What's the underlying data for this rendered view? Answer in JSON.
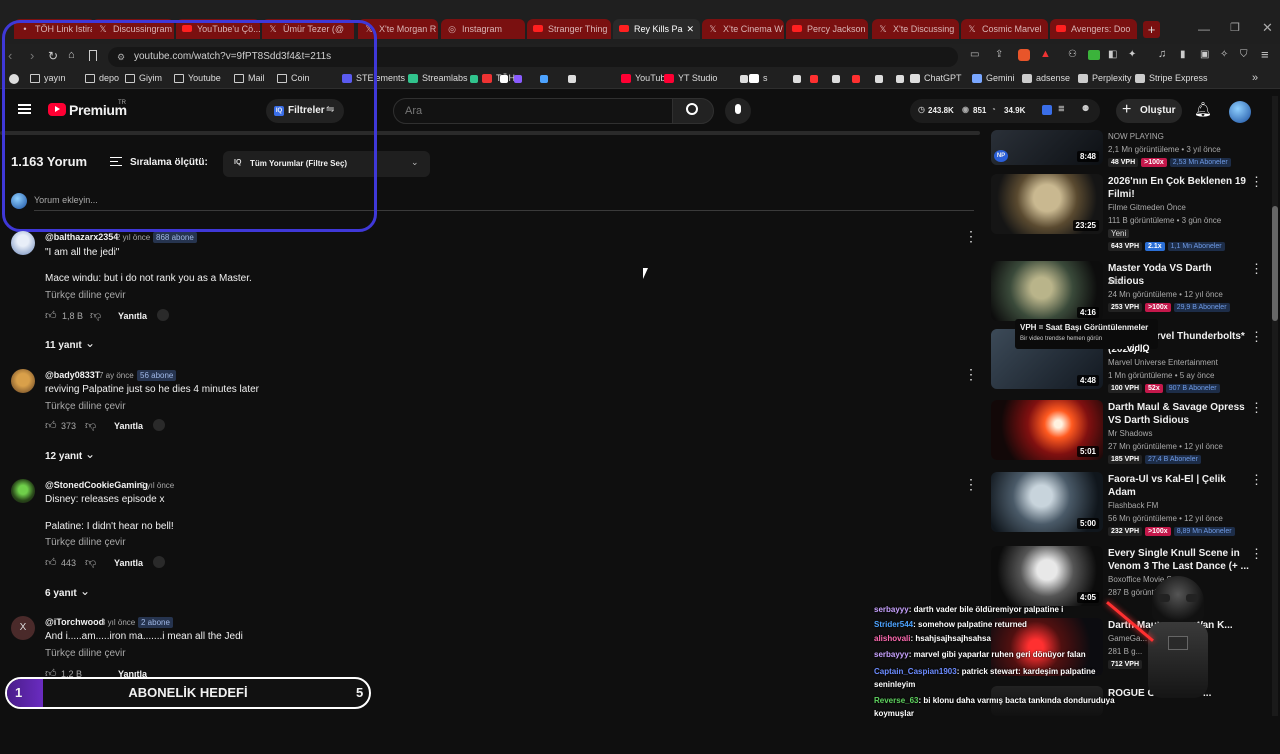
{
  "browser": {
    "tabs": [
      {
        "label": "TÖH Link Istiraki"
      },
      {
        "label": "Discussingram"
      },
      {
        "label": "YouTube'u Çö..."
      },
      {
        "label": "Ümür Tezer (@"
      },
      {
        "label": "X'te Morgan R"
      },
      {
        "label": "Instagram"
      },
      {
        "label": "Stranger Thing"
      },
      {
        "label": "Rey Kills Pa"
      },
      {
        "label": "X'te Cinema W"
      },
      {
        "label": "Percy Jackson"
      },
      {
        "label": "X'te Discussing"
      },
      {
        "label": "Cosmic Marvel"
      },
      {
        "label": "Avengers: Doo"
      }
    ],
    "url": "youtube.com/watch?v=9fPT8Sdd3f4&t=211s",
    "bookmarks": [
      "yayın",
      "depo",
      "Giyim",
      "Youtube",
      "Mail",
      "Coin",
      "STElements",
      "Streamlabs",
      "TÖH",
      "YouTube",
      "YT Studio",
      "s",
      "ChatGPT",
      "Gemini",
      "adsense",
      "Perplexity",
      "Stripe Express"
    ]
  },
  "yt": {
    "logo": "Premium",
    "logo_region": "TR",
    "filters_label": "Filtreler",
    "search_placeholder": "Ara",
    "stats": {
      "a": "243.8K",
      "b": "851",
      "c": "34.9K"
    },
    "create_label": "Oluştur"
  },
  "comments_header": {
    "count": "1.163 Yorum",
    "sort_label": "Sıralama ölçütü:",
    "filter_value": "Tüm Yorumlar (Filtre Seç)",
    "add_placeholder": "Yorum ekleyin..."
  },
  "comments": [
    {
      "user": "@balthazarx2354",
      "ago": "2 yıl önce",
      "subs": "868 abone",
      "lines": [
        "\"I am all the jedi\"",
        "Mace windu: but i do not rank you as a Master."
      ],
      "translate": "Türkçe diline çevir",
      "likes": "1,8 B",
      "reply": "Yanıtla",
      "replies": "11 yanıt"
    },
    {
      "user": "@bady0833T",
      "ago": "7 ay önce",
      "subs": "56 abone",
      "lines": [
        "reviving Palpatine just so he dies 4 minutes later"
      ],
      "translate": "Türkçe diline çevir",
      "likes": "373",
      "reply": "Yanıtla",
      "replies": "12 yanıt"
    },
    {
      "user": "@StonedCookieGaming",
      "ago": "2 yıl önce",
      "subs": "",
      "lines": [
        "Disney: releases episode x",
        "Palatine: I didn't hear no bell!"
      ],
      "translate": "Türkçe diline çevir",
      "likes": "443",
      "reply": "Yanıtla",
      "replies": "6 yanıt"
    },
    {
      "user": "@iTorchwood",
      "ago": "3 yıl önce",
      "subs": "2 abone",
      "avatar_letter": "X",
      "lines": [
        "And i.....am.....iron ma.......i mean all the Jedi"
      ],
      "translate": "Türkçe diline çevir",
      "likes": "1,2 B",
      "reply": "Yanıtla",
      "replies": ""
    }
  ],
  "sidebar": [
    {
      "title": "",
      "channel": "NOW PLAYING",
      "views": "2,1 Mn görüntüleme • 3 yıl önce",
      "duration": "8:48",
      "vph": "48 VPH",
      "mult": ">100x",
      "mult_color": "#c4184b",
      "subs": "2,53 Mn Aboneler"
    },
    {
      "title": "2026'nın En Çok Beklenen 19 Filmi!",
      "channel": "Filme Gitmeden Önce",
      "views": "111 B görüntüleme • 3 gün önce",
      "badge": "Yeni",
      "duration": "23:25",
      "vph": "643 VPH",
      "mult": "2.1x",
      "mult_color": "#2b6fd6",
      "subs": "1,1 Mn Aboneler"
    },
    {
      "title": "Master Yoda VS Darth Sidious",
      "channel": "Alex",
      "views": "24 Mn görüntüleme • 12 yıl önce",
      "duration": "4:16",
      "vph": "253 VPH",
      "mult": ">100x",
      "mult_color": "#c4184b",
      "subs": "29,9 B Aboneler"
    },
    {
      "title": "'Void' - Marvel Thunderbolts* (2025) ...",
      "channel": "Marvel Universe Entertainment",
      "views": "1 Mn görüntüleme • 5 ay önce",
      "duration": "4:48",
      "vph": "100 VPH",
      "mult": "52x",
      "mult_color": "#c4184b",
      "subs": "907 B Aboneler"
    },
    {
      "title": "Darth Maul & Savage Opress VS Darth Sidious",
      "channel": "Mr Shadows",
      "views": "27 Mn görüntüleme • 12 yıl önce",
      "duration": "5:01",
      "vph": "185 VPH",
      "mult": "",
      "mult_color": "#c4184b",
      "subs": "27,4 B Aboneler"
    },
    {
      "title": "Faora-Ul vs Kal-El | Çelik Adam",
      "channel": "Flashback FM",
      "views": "56 Mn görüntüleme • 12 yıl önce",
      "duration": "5:00",
      "vph": "232 VPH",
      "mult": ">100x",
      "mult_color": "#c4184b",
      "subs": "8,89 Mn Aboneler"
    },
    {
      "title": "Every Single Knull Scene in Venom 3 The Last Dance (+ ...",
      "channel": "Boxoffice Movie S...",
      "views": "287 B görüntü...",
      "duration": "4:05",
      "vph": "",
      "mult": "",
      "mult_color": "#c4184b",
      "subs": ""
    },
    {
      "title": "Darth Maul ... Obi-Wan K...",
      "channel": "GameGa...",
      "views": "281 B g...",
      "duration": "",
      "vph": "712 VPH",
      "mult": "",
      "mult_color": "#c4184b",
      "subs": ""
    },
    {
      "title": "ROGUE ONE Movie ...",
      "channel": "",
      "views": "",
      "duration": "",
      "vph": "",
      "mult": "",
      "mult_color": "#c4184b",
      "subs": ""
    }
  ],
  "tooltip": {
    "title": "VPH = Saat Başı Görüntülenmeler",
    "body": "Bir video trendse hemen görün",
    "brand": "vidIQ"
  },
  "chat": [
    {
      "user": "serbayyy",
      "color": "#c8a2ff",
      "msg": ": darth vader bile öldüremiyor palpatine i"
    },
    {
      "user": "Strider544",
      "color": "#4da3ff",
      "msg": ": somehow palpatine returned"
    },
    {
      "user": "alishovali",
      "color": "#ff6ab0",
      "msg": ": hsahjsajhsajhsahsa"
    },
    {
      "user": "serbayyy",
      "color": "#c8a2ff",
      "msg": ": marvel gibi yaparlar ruhen geri dönüyor falan"
    },
    {
      "user": "Captain_Caspian1903",
      "color": "#6c8cff",
      "msg": ": patrick stewart: kardeşim palpatine seninleyim"
    },
    {
      "user": "Reverse_63",
      "color": "#5fd35f",
      "msg": ": bi klonu daha varmış bacta tankında donduruduya koymuşlar"
    }
  ],
  "goal": {
    "start": "1",
    "label": "ABONELİK HEDEFİ",
    "end": "5",
    "progress": 0.1
  },
  "colors": {
    "annotation": "#3f38d8",
    "yt_red": "#ff0033",
    "tab_red": "#7a1010"
  }
}
